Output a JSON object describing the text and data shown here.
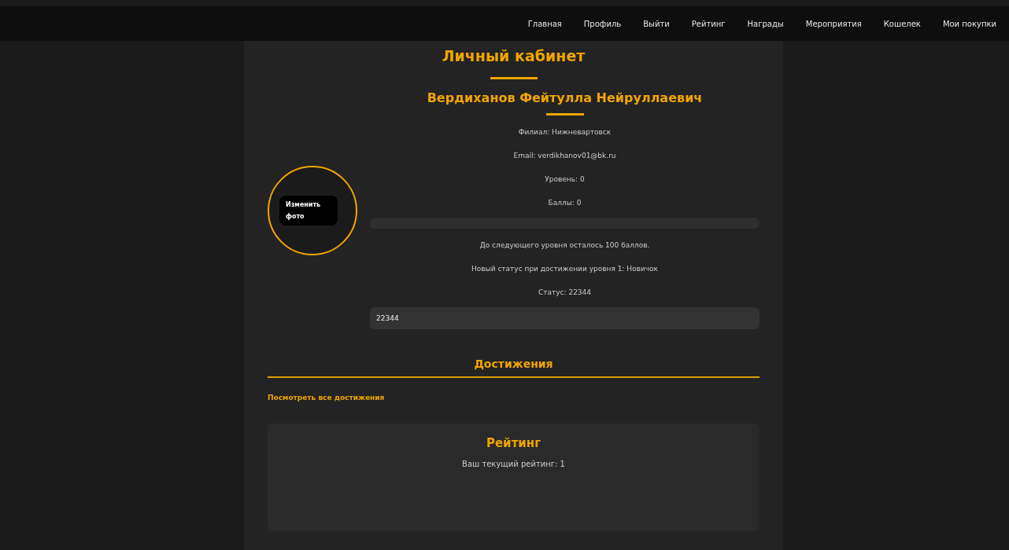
{
  "nav": [
    {
      "label": "Главная"
    },
    {
      "label": "Профиль"
    },
    {
      "label": "Выйти"
    },
    {
      "label": "Рейтинг"
    },
    {
      "label": "Награды"
    },
    {
      "label": "Мероприятия"
    },
    {
      "label": "Кошелек"
    },
    {
      "label": "Мои покупки"
    }
  ],
  "title": "Личный кабинет",
  "name": "Вердиханов Фейтулла Нейруллаевич",
  "avatar": {
    "button": "Изменить фото"
  },
  "info": [
    "Филиал: Нижневартовск",
    "Email: verdikhanov01@bk.ru",
    "Уровень: 0",
    "Баллы: 0"
  ],
  "progress": {
    "level": 0
  },
  "notes": [
    "До следующего уровня осталось 100 баллов.",
    "Новый статус при достижении уровня 1: Новичок",
    "Статус: 22344"
  ],
  "status_field": {
    "value": "22344"
  },
  "achievements": {
    "title": "Достижения",
    "link": "Посмотреть все достижения"
  },
  "rating": {
    "title": "Рейтинг",
    "text": "Ваш текущий рейтинг: 1"
  }
}
